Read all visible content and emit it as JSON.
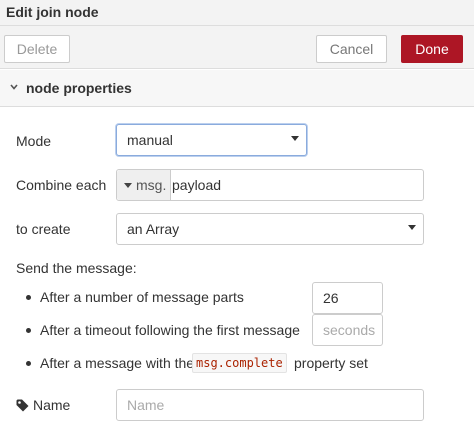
{
  "title": "Edit join node",
  "toolbar": {
    "delete_label": "Delete",
    "cancel_label": "Cancel",
    "done_label": "Done"
  },
  "section": {
    "label": "node properties"
  },
  "form": {
    "mode_label": "Mode",
    "mode_value": "manual",
    "combine_label": "Combine each",
    "combine_prefix": "msg.",
    "combine_value": "payload",
    "create_label": "to create",
    "create_value": "an Array",
    "send_label": "Send the message:",
    "bullets": [
      {
        "text": "After a number of message parts",
        "input_value": "26"
      },
      {
        "text": "After a timeout following the first message",
        "input_placeholder": "seconds"
      },
      {
        "text_before": "After a message with the",
        "code": "msg.complete",
        "text_after": "property set"
      }
    ],
    "name_label": "Name",
    "name_placeholder": "Name"
  },
  "colors": {
    "done_button": "#ad1625",
    "header_bg": "#f3f3f3",
    "focus_border": "#8aabdd"
  }
}
